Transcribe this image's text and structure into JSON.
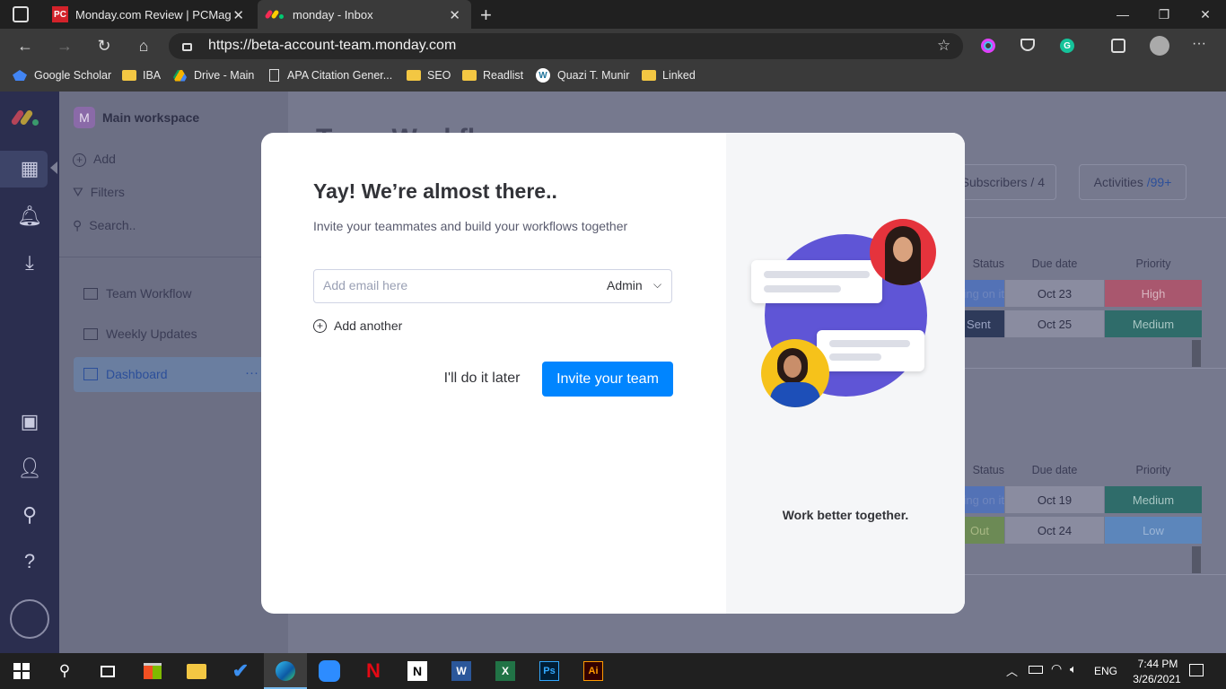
{
  "browser": {
    "tabs": [
      {
        "title": "Monday.com Review | PCMag",
        "favicon": "pcmag-icon"
      },
      {
        "title": "monday - Inbox",
        "favicon": "monday-icon"
      }
    ],
    "url": "https://beta-account-team.monday.com",
    "bookmarks": [
      "Google Scholar",
      "IBA",
      "Drive - Main",
      "APA Citation Gener...",
      "SEO",
      "Readlist",
      "Quazi T. Munir",
      "Linked"
    ]
  },
  "workspace": {
    "title": "Main workspace",
    "initial": "M",
    "add_label": "Add",
    "filters_label": "Filters",
    "search_label": "Search..",
    "boards": [
      "Team Workflow",
      "Weekly Updates",
      "Dashboard"
    ]
  },
  "board": {
    "heading": "Team Workflow",
    "subscribers": "Subscribers / 4",
    "activities_label": "Activities",
    "activities_count": "/99+",
    "col_status": "Status",
    "col_due": "Due date",
    "col_priority": "Priority",
    "group1": [
      {
        "status": "Working on it",
        "due": "Oct 23",
        "priority": "High"
      },
      {
        "status": "Sent",
        "due": "Oct 25",
        "priority": "Medium"
      }
    ],
    "group2": [
      {
        "status": "Working on it",
        "due": "Oct 19",
        "priority": "Medium"
      },
      {
        "status": "Out",
        "due": "Oct 24",
        "priority": "Low"
      }
    ],
    "colors": {
      "high": "#e2445c",
      "medium": "#037f4c",
      "low": "#579bfc",
      "working": "#fdab3d",
      "done": "#00c875"
    }
  },
  "modal": {
    "title": "Yay! We’re almost there..",
    "subtitle": "Invite your teammates and build your workflows together",
    "email_placeholder": "Add email here",
    "role": "Admin",
    "add_another": "Add another",
    "later_label": "I'll do it later",
    "invite_label": "Invite your team",
    "tagline": "Work better together.",
    "accent": "#0085ff"
  },
  "taskbar": {
    "lang": "ENG",
    "time": "7:44 PM",
    "date": "3/26/2021"
  }
}
